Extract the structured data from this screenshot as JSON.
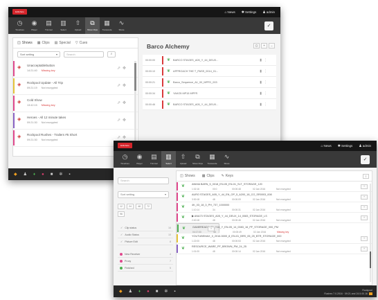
{
  "colors": {
    "brand": "#d4252b",
    "titlebar": "#161616",
    "toolbar": "#393939",
    "bottombar": "#262626",
    "pink": "#e0488d",
    "red": "#d93a3a",
    "green": "#4caf50",
    "orange": "#f0a020",
    "purple": "#8a63c4",
    "yellow": "#e6c43a"
  },
  "window1": {
    "logo": "Editshare",
    "top_links": [
      {
        "icon": "home-icon",
        "glyph": "⌂",
        "label": "News"
      },
      {
        "icon": "settings-icon",
        "glyph": "✱",
        "label": "Settings"
      },
      {
        "icon": "user-icon",
        "glyph": "♟",
        "label": "admin"
      }
    ],
    "toolbar": [
      {
        "icon": "clock-icon",
        "glyph": "◷",
        "label": "Timelines"
      },
      {
        "icon": "play-icon",
        "glyph": "◉",
        "label": "Player"
      },
      {
        "icon": "trim-icon",
        "glyph": "▤",
        "label": "Trimmer"
      },
      {
        "icon": "select-icon",
        "glyph": "▥",
        "label": "Select"
      },
      {
        "icon": "upload-icon",
        "glyph": "⇧",
        "label": "Upload"
      },
      {
        "icon": "show-clips-icon",
        "glyph": "⧉",
        "label": "Show Clips",
        "active": true
      },
      {
        "icon": "transcode-icon",
        "glyph": "▦",
        "label": "Transcode"
      },
      {
        "icon": "waveform-icon",
        "glyph": "∿",
        "label": "Share"
      }
    ],
    "left_tabs": [
      {
        "glyph": "◫",
        "label": "Shows",
        "active": true
      },
      {
        "glyph": "▦",
        "label": "Clips"
      },
      {
        "glyph": "▤",
        "label": "Special"
      },
      {
        "glyph": "▽",
        "label": "Cues"
      }
    ],
    "sort_select": "Sort setting",
    "search_placeholder": "Search",
    "timelines": [
      {
        "color": "#e0488d",
        "title": "Unacceptablebutton",
        "time": "14:21:40",
        "status": "Missing key"
      },
      {
        "color": "#e6c43a",
        "title": "Rockpool Update - All Trip",
        "time": "09:21:19",
        "status": "Not encrypted"
      },
      {
        "color": "#e0488d",
        "title": "Cold Show",
        "time": "13:42:15",
        "status": "Missing key"
      },
      {
        "color": "#8a63c4",
        "title": "Heroes - All 12 minute takes",
        "time": "09:21:30",
        "status": "Not encrypted"
      },
      {
        "color": "#e0488d",
        "title": "Rockpool Rushes - Trailers #5 Short",
        "time": "09:21:30",
        "status": "Not encrypted"
      }
    ],
    "bin_title": "Barco Alchemy",
    "bin_buttons": [
      "◻",
      "+",
      "–"
    ],
    "bin_clips": [
      {
        "tc": "00:00:00",
        "color": "#d93a3a",
        "name": "BARCO STAGES_A05_Y_44_DEUX..."
      },
      {
        "tc": "00:00:10",
        "color": "#d93a3a",
        "name": "APPROACH THE T_PASS_0014_01..."
      },
      {
        "tc": "00:00:21",
        "color": "#d93a3a",
        "name": "Barco_Sequence_A1_00_MPFD_003"
      },
      {
        "tc": "00:00:34",
        "color": "#d93a3a",
        "name": "YAKO5 MP15 MPFR"
      },
      {
        "tc": "00:00:46",
        "color": "#d93a3a",
        "name": "BARCO STAGES_A05_Y_44_DEUX..."
      }
    ],
    "bottom_icons": [
      {
        "icon": "folder-icon",
        "glyph": "◆",
        "tone": "orange"
      },
      {
        "icon": "person-icon",
        "glyph": "♟",
        "tone": ""
      },
      {
        "icon": "marker-icon",
        "glyph": "♦",
        "tone": "green"
      },
      {
        "icon": "record-icon",
        "glyph": "●",
        "tone": "pink"
      },
      {
        "icon": "square-icon",
        "glyph": "■",
        "tone": ""
      },
      {
        "icon": "gear-icon",
        "glyph": "✲",
        "tone": ""
      },
      {
        "icon": "grid-icon",
        "glyph": "▪",
        "tone": ""
      }
    ]
  },
  "window2": {
    "logo": "Editshare",
    "top_links": [
      {
        "icon": "home-icon",
        "glyph": "⌂",
        "label": "News"
      },
      {
        "icon": "settings-icon",
        "glyph": "✱",
        "label": "Settings"
      },
      {
        "icon": "user-icon",
        "glyph": "♟",
        "label": "admin"
      }
    ],
    "toolbar": [
      {
        "icon": "clock-icon",
        "glyph": "◷",
        "label": "Timelines"
      },
      {
        "icon": "play-icon",
        "glyph": "◉",
        "label": "Player"
      },
      {
        "icon": "trim-icon",
        "glyph": "▤",
        "label": "Trimmer"
      },
      {
        "icon": "select-icon",
        "glyph": "▥",
        "label": "Select",
        "active": true
      },
      {
        "icon": "upload-icon",
        "glyph": "⇧",
        "label": "Upload"
      },
      {
        "icon": "show-clips-icon",
        "glyph": "⧉",
        "label": "Show Clips"
      },
      {
        "icon": "transcode-icon",
        "glyph": "▦",
        "label": "Transcode"
      },
      {
        "icon": "waveform-icon",
        "glyph": "∿",
        "label": "Share"
      }
    ],
    "search_placeholder": "Search",
    "sort_select": "Sort setting",
    "chips": [
      "12",
      "24",
      "48",
      "72",
      "96"
    ],
    "filters_a": [
      {
        "color": "#4caf50",
        "label": "Clip status",
        "count": "16"
      },
      {
        "color": "#4caf50",
        "label": "Audio Status",
        "count": "10"
      },
      {
        "color": "#4caf50",
        "label": "Picture Edit",
        "count": "8"
      }
    ],
    "filters_b": [
      {
        "color": "#e0488d",
        "label": "New Receiver",
        "count": "4"
      },
      {
        "color": "#e0488d",
        "label": "Proxy",
        "count": "7"
      },
      {
        "color": "#4caf50",
        "label": "Finished",
        "count": "5"
      }
    ],
    "tabs": [
      {
        "glyph": "◫",
        "label": "Shows"
      },
      {
        "glyph": "▦",
        "label": "Clips"
      },
      {
        "glyph": "✎",
        "label": "Keys"
      }
    ],
    "clips": [
      {
        "color": "#e0488d",
        "name": "ANIMA BARN_5_0018_EN-05_EN-01_SLT_STORAGE_120",
        "tc": "1:32:16",
        "dur": "00:0",
        "size": "00:00:48",
        "date": "02 Jan 2016",
        "status": "Not encrypted"
      },
      {
        "color": "#e0488d",
        "name": "AURO STAGES_A05_Y_44_EN_OP_5_A200_18_CO_SR0003_008",
        "tc": "3:30:18",
        "dur": "48",
        "size": "00:00:09",
        "date": "02 Jan 2016",
        "status": "Not encrypted"
      },
      {
        "color": "#e0488d",
        "name": "4K_03_18_3_PH_737_1000000",
        "tc": "1:10:14",
        "dur": "34",
        "size": "00:00:31",
        "date": "02 Jan 2016",
        "status": "Not encrypted"
      },
      {
        "color": "#e0488d",
        "name": "▶ ANA73 STAGES_A05_Y_44_DEUX_14_0083_STORAGE_LS",
        "tc": "2:40:18",
        "dur": "48",
        "size": "00:00:46",
        "date": "02 Jan 2016",
        "status": "Not encrypted"
      },
      {
        "color": "#4caf50",
        "name": "GAMEREADY_01_Y16_Y_EN-05_14_0083_16_PF_STORAGE_000_PM",
        "tc": "04:17:00",
        "dur": "48",
        "size": "00:00:49",
        "date": "02 Jan 2016",
        "status": "Missing key"
      },
      {
        "color": "#e6c43a",
        "name": "YOUTUBEMAX_0_2016-5000_8_EN-01_BRS_05_25_BTR_STORAGE_000",
        "tc": "1:22:00",
        "dur": "48",
        "size": "00:00:53",
        "date": "02 Jan 2016",
        "status": "Not encrypted"
      },
      {
        "color": "#8a63c4",
        "name": "RESOURCE_WARE_PF_BROWN_PM_24_25",
        "tc": "1:01:00",
        "dur": "48",
        "size": "00:00:14",
        "date": "02 Jan 2016",
        "status": "Not encrypted"
      }
    ],
    "status_line1": "Rockpool",
    "status_line2": "Rushes 7.0.2016 · 09:21 and 24.5.00.16",
    "bottom_icons": [
      {
        "icon": "folder-icon",
        "glyph": "◆",
        "tone": "orange"
      },
      {
        "icon": "person-icon",
        "glyph": "♟",
        "tone": ""
      },
      {
        "icon": "marker-icon",
        "glyph": "♦",
        "tone": "green"
      },
      {
        "icon": "record-icon",
        "glyph": "●",
        "tone": "pink"
      },
      {
        "icon": "square-icon",
        "glyph": "■",
        "tone": ""
      },
      {
        "icon": "gear-icon",
        "glyph": "✲",
        "tone": ""
      },
      {
        "icon": "grid-icon",
        "glyph": "▪",
        "tone": ""
      }
    ]
  }
}
